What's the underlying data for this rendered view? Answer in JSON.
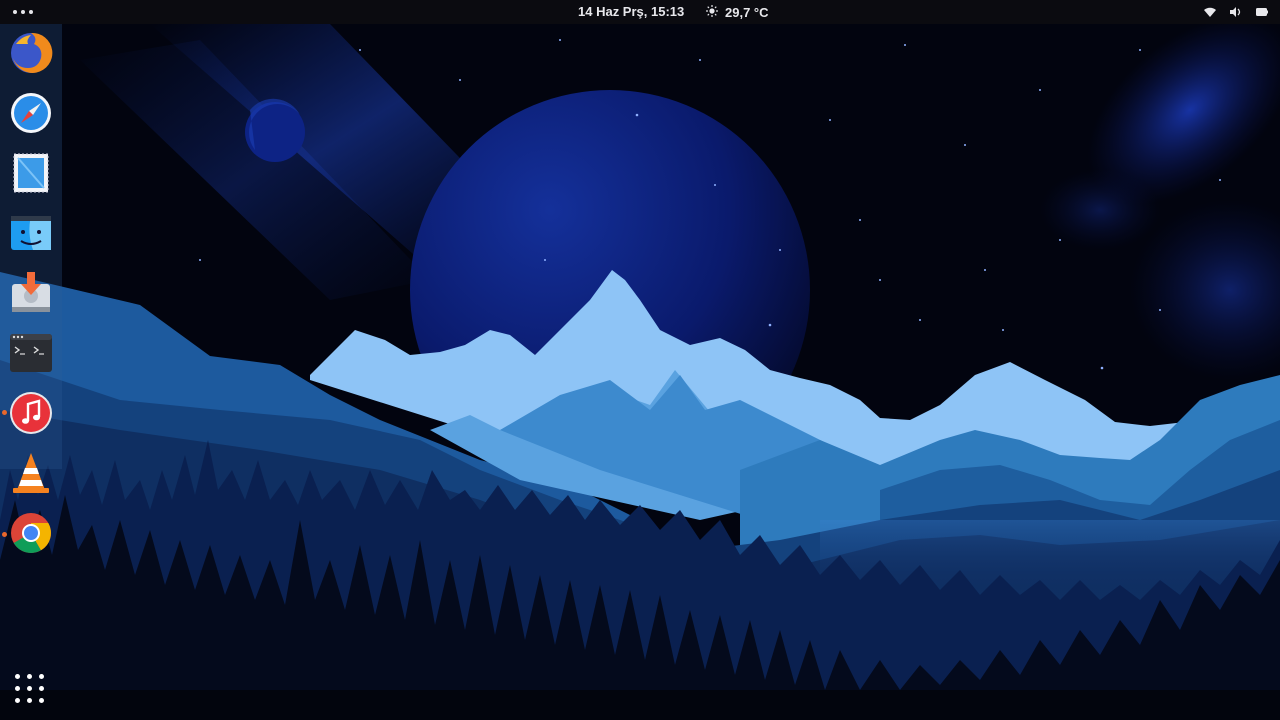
{
  "theme": {
    "sky_top": "#050b26",
    "sky_bottom": "#000000",
    "planet": "#0a1a7a",
    "peak_light": "#8ec4f6",
    "mid_blue": "#2e7bbd",
    "deep_blue": "#14427d",
    "forest": "#061030",
    "dock_tint": "#2d5f96",
    "running_indicator": "#e8672c"
  },
  "topbar": {
    "activities_icon": "dots-icon",
    "clock": "14 Haz Prş, 15:13",
    "weather": {
      "icon": "sun-icon",
      "temperature": "29,7 °C"
    },
    "status_icons": [
      "wifi-icon",
      "volume-icon",
      "battery-icon"
    ]
  },
  "dock": {
    "items": [
      {
        "name": "firefox",
        "icon": "firefox-icon",
        "running": false
      },
      {
        "name": "safari",
        "icon": "compass-icon",
        "running": false
      },
      {
        "name": "mail",
        "icon": "mail-stamp-icon",
        "running": false
      },
      {
        "name": "finder",
        "icon": "finder-icon",
        "running": false
      },
      {
        "name": "installer",
        "icon": "download-drive-icon",
        "running": false
      },
      {
        "name": "terminal",
        "icon": "terminal-icon",
        "running": false
      },
      {
        "name": "music",
        "icon": "music-note-icon",
        "running": true
      },
      {
        "name": "vlc",
        "icon": "vlc-cone-icon",
        "running": false
      },
      {
        "name": "chrome",
        "icon": "chrome-icon",
        "running": true
      }
    ],
    "show_apps_icon": "grid-dots-icon"
  }
}
